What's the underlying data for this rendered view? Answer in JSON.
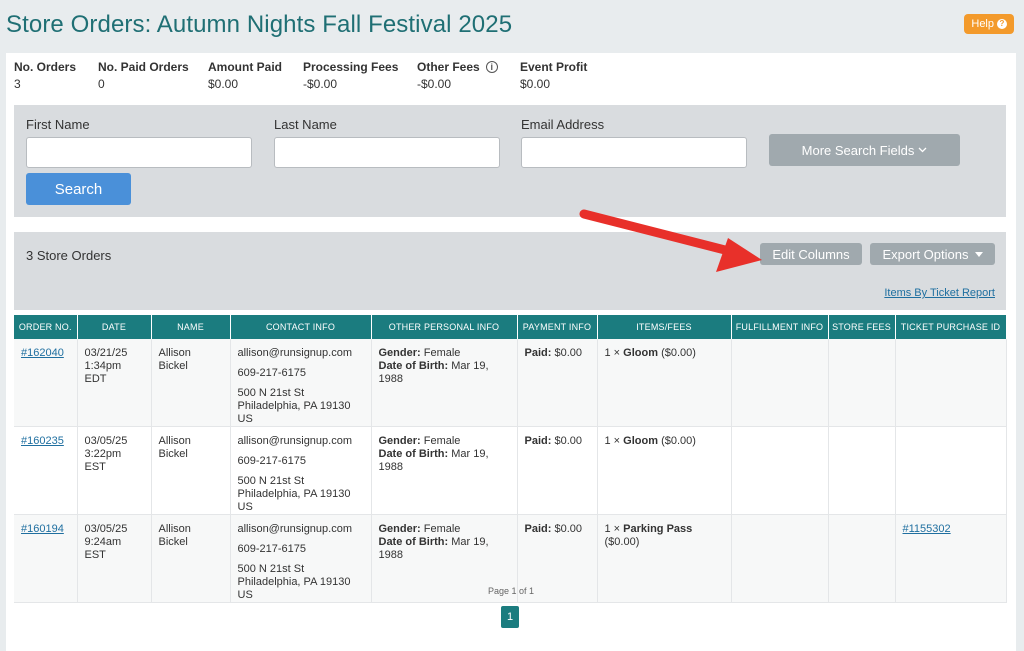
{
  "header": {
    "title": "Store Orders: Autumn Nights Fall Festival 2025",
    "help_label": "Help",
    "help_icon": "?"
  },
  "stats": [
    {
      "label": "No. Orders",
      "value": "3"
    },
    {
      "label": "No. Paid Orders",
      "value": "0"
    },
    {
      "label": "Amount Paid",
      "value": "$0.00"
    },
    {
      "label": "Processing Fees",
      "value": "-$0.00"
    },
    {
      "label": "Other Fees",
      "value": "-$0.00"
    },
    {
      "label": "Event Profit",
      "value": "$0.00"
    }
  ],
  "search": {
    "first_name_label": "First Name",
    "last_name_label": "Last Name",
    "email_label": "Email Address",
    "more_fields_label": "More Search Fields",
    "search_button": "Search"
  },
  "results": {
    "count_label": "3 Store Orders",
    "edit_columns": "Edit Columns",
    "export_options": "Export Options",
    "items_by_ticket_report": "Items By Ticket Report"
  },
  "table": {
    "headers": [
      "ORDER NO.",
      "DATE",
      "NAME",
      "CONTACT INFO",
      "OTHER PERSONAL INFO",
      "PAYMENT INFO",
      "ITEMS/FEES",
      "FULFILLMENT INFO",
      "STORE FEES",
      "TICKET PURCHASE ID"
    ],
    "rows": [
      {
        "order": "#162040",
        "date1": "03/21/25",
        "date2": "1:34pm EDT",
        "name": "Allison Bickel",
        "email": "allison@runsignup.com",
        "phone": "609-217-6175",
        "addr1": "500 N 21st St",
        "addr2": "Philadelphia, PA 19130 US",
        "gender_label": "Gender:",
        "gender": "Female",
        "dob_label": "Date of Birth:",
        "dob": "Mar 19, 1988",
        "paid_label": "Paid:",
        "paid": "$0.00",
        "qty": "1 ×",
        "item": "Gloom",
        "item_price": "($0.00)",
        "fulfillment": "",
        "store_fees": "",
        "ticket_id": ""
      },
      {
        "order": "#160235",
        "date1": "03/05/25",
        "date2": "3:22pm EST",
        "name": "Allison Bickel",
        "email": "allison@runsignup.com",
        "phone": "609-217-6175",
        "addr1": "500 N 21st St",
        "addr2": "Philadelphia, PA 19130 US",
        "gender_label": "Gender:",
        "gender": "Female",
        "dob_label": "Date of Birth:",
        "dob": "Mar 19, 1988",
        "paid_label": "Paid:",
        "paid": "$0.00",
        "qty": "1 ×",
        "item": "Gloom",
        "item_price": "($0.00)",
        "fulfillment": "",
        "store_fees": "",
        "ticket_id": ""
      },
      {
        "order": "#160194",
        "date1": "03/05/25",
        "date2": "9:24am EST",
        "name": "Allison Bickel",
        "email": "allison@runsignup.com",
        "phone": "609-217-6175",
        "addr1": "500 N 21st St",
        "addr2": "Philadelphia, PA 19130 US",
        "gender_label": "Gender:",
        "gender": "Female",
        "dob_label": "Date of Birth:",
        "dob": "Mar 19, 1988",
        "paid_label": "Paid:",
        "paid": "$0.00",
        "qty": "1 ×",
        "item": "Parking Pass",
        "item_price": "($0.00)",
        "fulfillment": "",
        "store_fees": "",
        "ticket_id": "#1155302"
      }
    ]
  },
  "pager": {
    "text": "Page 1 of 1",
    "current": "1"
  },
  "colors": {
    "accent": "#1b7c7f",
    "title": "#1f6f74",
    "help": "#f39a2b",
    "search": "#4a90d9",
    "arrow": "#e8302a"
  }
}
